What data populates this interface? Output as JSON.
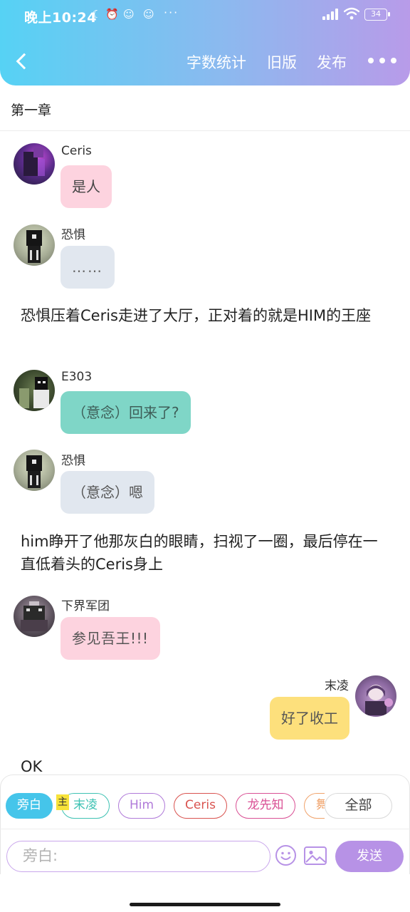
{
  "status_bar": {
    "time": "晚上10:24",
    "battery": "34",
    "more_dots": "···"
  },
  "nav": {
    "word_count": "字数统计",
    "old_version": "旧版",
    "publish": "发布"
  },
  "chapter": {
    "title": "第一章"
  },
  "messages": [
    {
      "sender": "Ceris",
      "text": "是人",
      "bubble_color": "#fdd3df"
    },
    {
      "sender": "恐惧",
      "text": "……",
      "bubble_color": "#e1e7ef"
    },
    {
      "narration": "恐惧压着Ceris走进了大厅，正对着的就是HIM的王座"
    },
    {
      "sender": "E303",
      "text": "（意念）回来了?",
      "bubble_color": "#7fd6c7"
    },
    {
      "sender": "恐惧",
      "text": "（意念）嗯",
      "bubble_color": "#e1e7ef"
    },
    {
      "narration": "him睁开了他那灰白的眼睛，扫视了一圈，最后停在一直低着头的Ceris身上"
    },
    {
      "sender": "下界军团",
      "text": "参见吾王!!!",
      "bubble_color": "#fdd3df"
    },
    {
      "sender": "末凌",
      "text": "好了收工",
      "bubble_color": "#fde07c"
    },
    {
      "narration": "OK"
    }
  ],
  "roles": [
    {
      "label": "旁白",
      "color": "#45c5ea",
      "active": true
    },
    {
      "label": "末凌",
      "color": "#3ec2b3"
    },
    {
      "label": "Him",
      "color": "#b07ad9"
    },
    {
      "label": "Ceris",
      "color": "#d9534f"
    },
    {
      "label": "龙先知",
      "color": "#d94f94"
    },
    {
      "label": "舞",
      "color": "#f0a36b"
    }
  ],
  "host_tag": "主",
  "all_button": "全部",
  "input": {
    "placeholder": "旁白:"
  },
  "send_button": "发送",
  "colors": {
    "header_start": "#56d2f4",
    "header_end": "#b89be9",
    "send": "#b792e6",
    "accent": "#45c5ea"
  }
}
